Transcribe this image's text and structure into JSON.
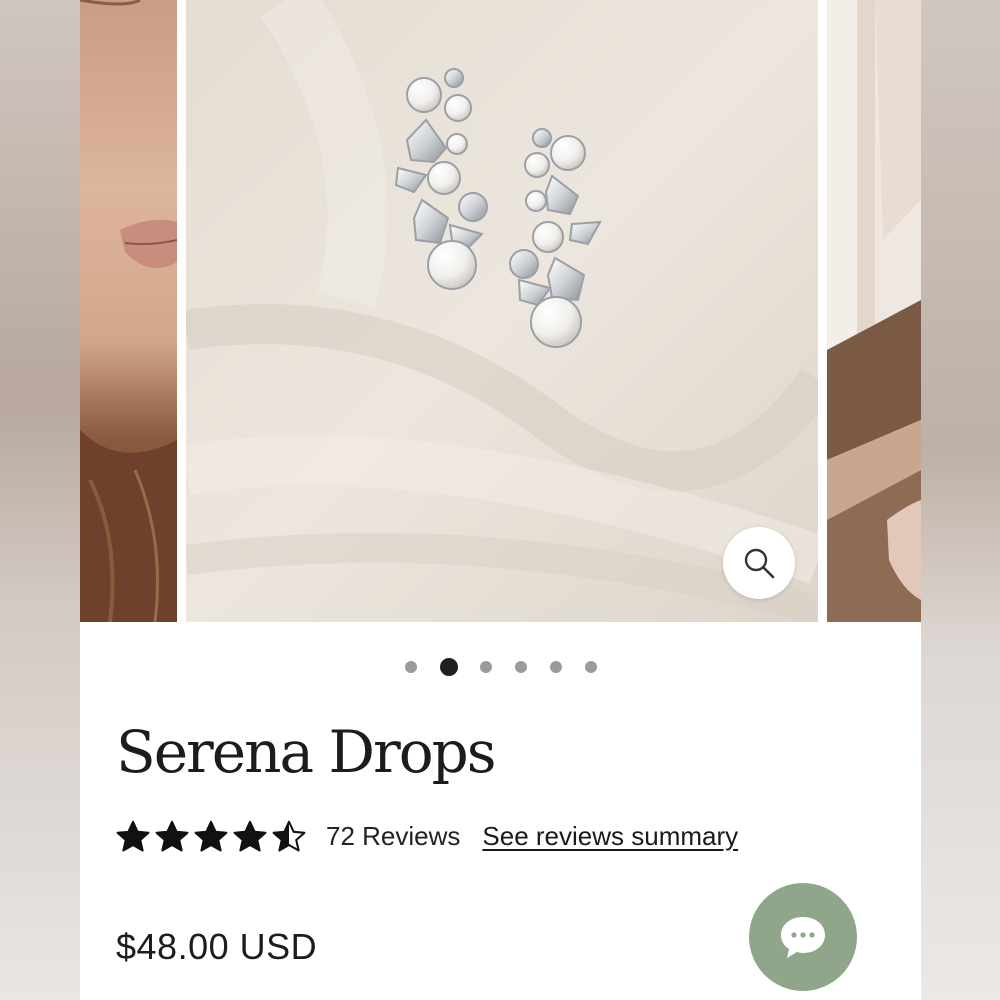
{
  "product": {
    "title": "Serena Drops",
    "rating": 4.5,
    "rating_max": 5,
    "reviews_count_label": "72 Reviews",
    "reviews_link_label": "See reviews summary",
    "price": "$48.00 USD"
  },
  "carousel": {
    "slide_count": 6,
    "active_index": 1
  },
  "icons": {
    "zoom": "magnifier-icon",
    "chat": "chat-bubble-icon",
    "star": "star-icon"
  },
  "colors": {
    "chat_button": "#8fa68b",
    "active_dot": "#1f1f1f",
    "inactive_dot": "#9b9b9b",
    "text": "#1c1c1c"
  }
}
